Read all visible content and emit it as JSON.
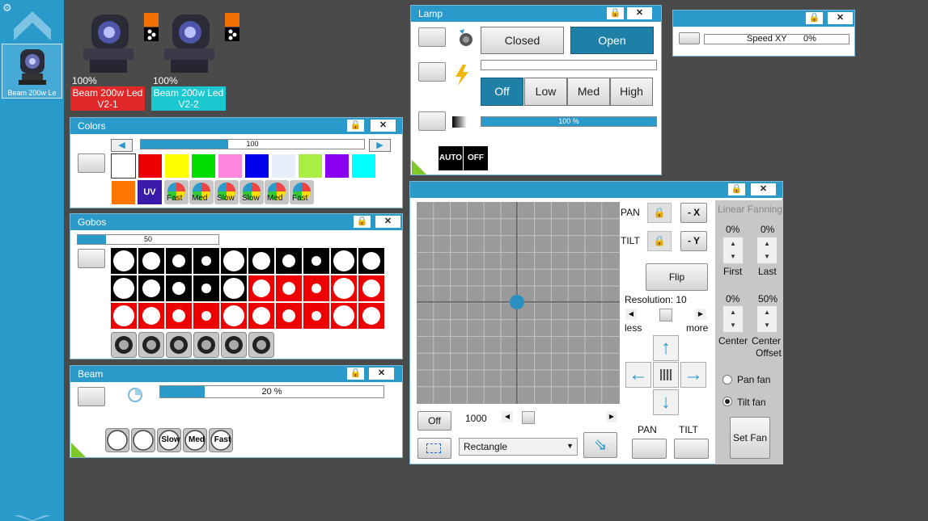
{
  "sidebar": {
    "settings_icon": "gear-icon",
    "up_icon": "chevron-up-icon",
    "down_icon": "chevron-down-icon",
    "fixture_label": "Beam 200w Le"
  },
  "fixtures": [
    {
      "intensity": "100%",
      "name": "Beam 200w Led V2-1",
      "color": "#e02828"
    },
    {
      "intensity": "100%",
      "name": "Beam 200w Led V2-2",
      "color": "#1cc8d0"
    }
  ],
  "lamp": {
    "title": "Lamp",
    "closed": "Closed",
    "open": "Open",
    "active_shutter": "Open",
    "power_levels": [
      "Off",
      "Low",
      "Med",
      "High"
    ],
    "active_level": "Off",
    "dimmer": "100 %",
    "dimmer_level": 1.0,
    "auto": "AUTO",
    "off": "OFF"
  },
  "speed": {
    "label": "Speed XY",
    "value": "0%"
  },
  "colors": {
    "title": "Colors",
    "slider": "100",
    "slider_level": 0.39,
    "swatches": [
      "#ffffff",
      "#ee0000",
      "#ffff00",
      "#00dd00",
      "#ff88dd",
      "#0000ee",
      "#e8eefa",
      "#aaee44",
      "#8800ee",
      "#00ffff",
      "#ff7700"
    ],
    "uv_label": "UV",
    "wheel_labels": [
      "Fast",
      "Med",
      "Slow",
      "Slow",
      "Med",
      "Fast"
    ]
  },
  "gobos": {
    "title": "Gobos",
    "slider": "50",
    "slider_level": 0.2
  },
  "beam": {
    "title": "Beam",
    "slider": "20 %",
    "slider_level": 0.2,
    "wheel_labels": [
      "",
      "",
      "Slow",
      "Med",
      "Fast"
    ]
  },
  "position": {
    "pan": "PAN",
    "tilt": "TILT",
    "minus_x": "- X",
    "minus_y": "- Y",
    "flip": "Flip",
    "resolution": "Resolution: 10",
    "less": "less",
    "more": "more",
    "off": "Off",
    "time": "1000",
    "shape": "Rectangle",
    "pan_btn": "PAN",
    "tilt_btn": "TILT",
    "linear_fanning": "Linear Fanning",
    "first_val": "0%",
    "last_val": "0%",
    "first": "First",
    "last": "Last",
    "center_val": "0%",
    "center_offset_val": "50%",
    "center": "Center",
    "center_offset_1": "Center",
    "center_offset_2": "Offset",
    "pan_fan": "Pan fan",
    "tilt_fan": "Tilt fan",
    "set_fan": "Set Fan"
  }
}
